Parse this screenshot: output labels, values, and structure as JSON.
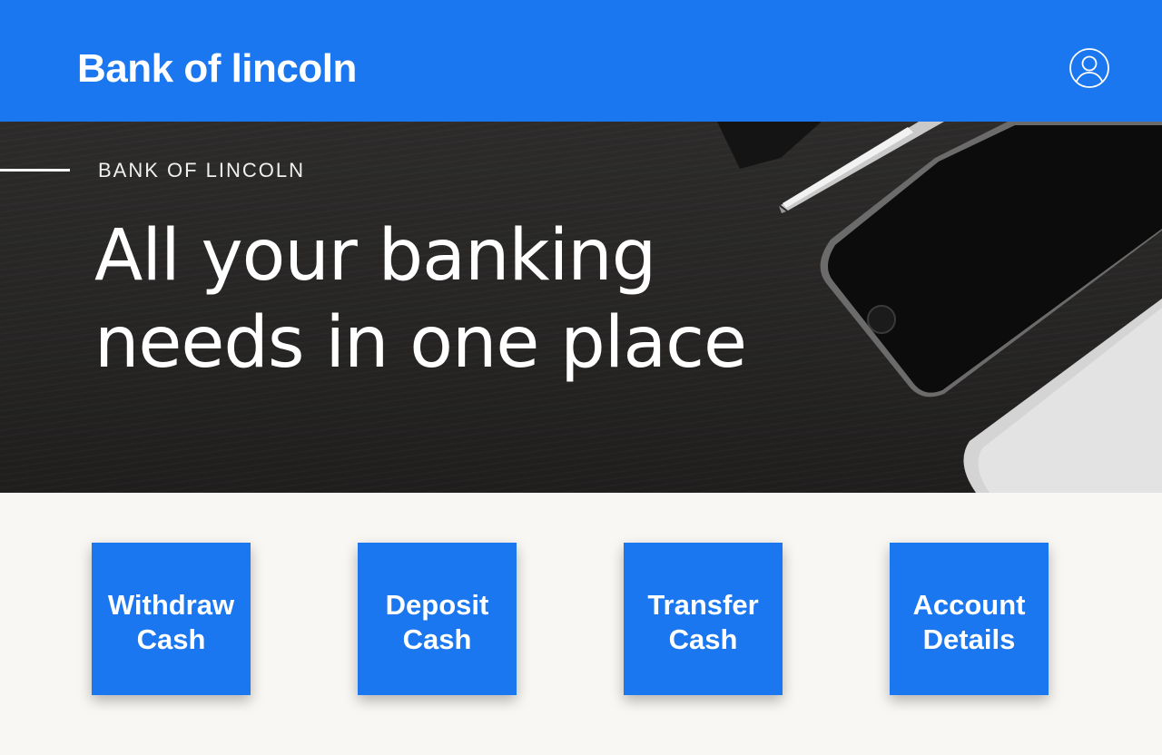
{
  "header": {
    "brand": "Bank of lincoln",
    "profile_icon": "user-profile-icon"
  },
  "hero": {
    "kicker": "BANK OF LINCOLN",
    "title_line1": "All your banking",
    "title_line2": "needs in one place"
  },
  "actions": [
    {
      "line1": "Withdraw",
      "line2": "Cash"
    },
    {
      "line1": "Deposit",
      "line2": "Cash"
    },
    {
      "line1": "Transfer",
      "line2": "Cash"
    },
    {
      "line1": "Account",
      "line2": "Details"
    }
  ],
  "colors": {
    "primary": "#1a77ef",
    "page_background": "#f8f7f3",
    "hero_background": "#262524",
    "text_on_primary": "#ffffff"
  }
}
